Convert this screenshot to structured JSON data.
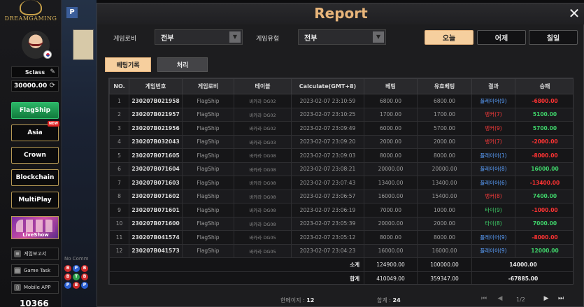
{
  "sidebar": {
    "logo_text": "DREAMGAMING",
    "user_name": "Sclass",
    "balance": "30000.00",
    "buttons": [
      {
        "label": "FlagShip",
        "active": true
      },
      {
        "label": "Asia",
        "badge": "NEW"
      },
      {
        "label": "Crown"
      },
      {
        "label": "Blockchain"
      },
      {
        "label": "MultiPlay"
      }
    ],
    "promo_label": "LiveShow",
    "links": [
      {
        "label": "게임보고서",
        "icon": "report-icon"
      },
      {
        "label": "Game Task",
        "icon": "task-icon"
      },
      {
        "label": "Mobile APP",
        "icon": "mobile-icon"
      }
    ],
    "bottom_number": "10366"
  },
  "background": {
    "p_marker": "P",
    "no_comm": "No Comm",
    "road_dots": [
      "B",
      "B",
      "P",
      "P",
      "T",
      "B",
      "B",
      "B",
      "P"
    ]
  },
  "modal": {
    "title": "Report",
    "close_glyph": "✕",
    "filters": {
      "lobby_label": "게임로비",
      "lobby_value": "전부",
      "type_label": "게임유형",
      "type_value": "전부"
    },
    "date_buttons": [
      "오늘",
      "어제",
      "칠일"
    ],
    "tabs": [
      "베팅기록",
      "처리"
    ],
    "columns": [
      "NO.",
      "게임번호",
      "게임로비",
      "테이블",
      "Calculate(GMT+8)",
      "베팅",
      "유효베팅",
      "결과",
      "승패"
    ],
    "rows": [
      {
        "no": "1",
        "id": "230207B021958",
        "lobby": "FlagShip",
        "table": "바카라 DG02",
        "time": "2023-02-07 23:10:59",
        "bet": "6800.00",
        "valid": "6800.00",
        "result": "플레이어(9)",
        "result_color": "blue",
        "winloss": "-6800.00"
      },
      {
        "no": "2",
        "id": "230207B021957",
        "lobby": "FlagShip",
        "table": "바카라 DG02",
        "time": "2023-02-07 23:10:25",
        "bet": "1700.00",
        "valid": "1700.00",
        "result": "뱅커(7)",
        "result_color": "red",
        "winloss": "5100.00"
      },
      {
        "no": "3",
        "id": "230207B021956",
        "lobby": "FlagShip",
        "table": "바카라 DG02",
        "time": "2023-02-07 23:09:49",
        "bet": "6000.00",
        "valid": "5700.00",
        "result": "뱅커(9)",
        "result_color": "red",
        "winloss": "5700.00"
      },
      {
        "no": "4",
        "id": "230207B032043",
        "lobby": "FlagShip",
        "table": "바카라 DG03",
        "time": "2023-02-07 23:09:20",
        "bet": "2000.00",
        "valid": "2000.00",
        "result": "뱅커(7)",
        "result_color": "red",
        "winloss": "-2000.00"
      },
      {
        "no": "5",
        "id": "230207B071605",
        "lobby": "FlagShip",
        "table": "바카라 DG08",
        "time": "2023-02-07 23:09:03",
        "bet": "8000.00",
        "valid": "8000.00",
        "result": "플레이어(1)",
        "result_color": "blue",
        "winloss": "-8000.00"
      },
      {
        "no": "6",
        "id": "230207B071604",
        "lobby": "FlagShip",
        "table": "바카라 DG08",
        "time": "2023-02-07 23:08:21",
        "bet": "20000.00",
        "valid": "20000.00",
        "result": "플레이어(8)",
        "result_color": "blue",
        "winloss": "16000.00"
      },
      {
        "no": "7",
        "id": "230207B071603",
        "lobby": "FlagShip",
        "table": "바카라 DG08",
        "time": "2023-02-07 23:07:43",
        "bet": "13400.00",
        "valid": "13400.00",
        "result": "플레이어(6)",
        "result_color": "blue",
        "winloss": "-13400.00"
      },
      {
        "no": "8",
        "id": "230207B071602",
        "lobby": "FlagShip",
        "table": "바카라 DG08",
        "time": "2023-02-07 23:06:57",
        "bet": "16000.00",
        "valid": "15400.00",
        "result": "뱅커(8)",
        "result_color": "red",
        "winloss": "7400.00"
      },
      {
        "no": "9",
        "id": "230207B071601",
        "lobby": "FlagShip",
        "table": "바카라 DG08",
        "time": "2023-02-07 23:06:19",
        "bet": "7000.00",
        "valid": "1000.00",
        "result": "타이(9)",
        "result_color": "green",
        "winloss": "-1000.00"
      },
      {
        "no": "10",
        "id": "230207B071600",
        "lobby": "FlagShip",
        "table": "바카라 DG08",
        "time": "2023-02-07 23:05:39",
        "bet": "20000.00",
        "valid": "2000.00",
        "result": "타이(8)",
        "result_color": "green",
        "winloss": "7000.00"
      },
      {
        "no": "11",
        "id": "230207B041574",
        "lobby": "FlagShip",
        "table": "바카라 DG05",
        "time": "2023-02-07 23:05:12",
        "bet": "8000.00",
        "valid": "8000.00",
        "result": "플레이어(9)",
        "result_color": "blue",
        "winloss": "-8000.00"
      },
      {
        "no": "12",
        "id": "230207B041573",
        "lobby": "FlagShip",
        "table": "바카라 DG05",
        "time": "2023-02-07 23:04:23",
        "bet": "16000.00",
        "valid": "16000.00",
        "result": "플레이어(9)",
        "result_color": "blue",
        "winloss": "12000.00"
      }
    ],
    "subtotal": {
      "label": "소계",
      "bet": "124900.00",
      "valid": "100000.00",
      "winloss": "14000.00"
    },
    "total": {
      "label": "합계",
      "bet": "410049.00",
      "valid": "359347.00",
      "winloss": "-67885.00"
    },
    "footer": {
      "page_size_label": "한페이지 :",
      "page_size": "12",
      "total_label": "합계 :",
      "total_count": "24",
      "page_indicator": "1/2"
    },
    "colors": {
      "accent": "#f6cf9e",
      "title": "#e8b57a",
      "win": "#3fd36a",
      "loss": "#ff3333",
      "player": "#5aa0ff",
      "banker": "#ff3b3b"
    }
  }
}
